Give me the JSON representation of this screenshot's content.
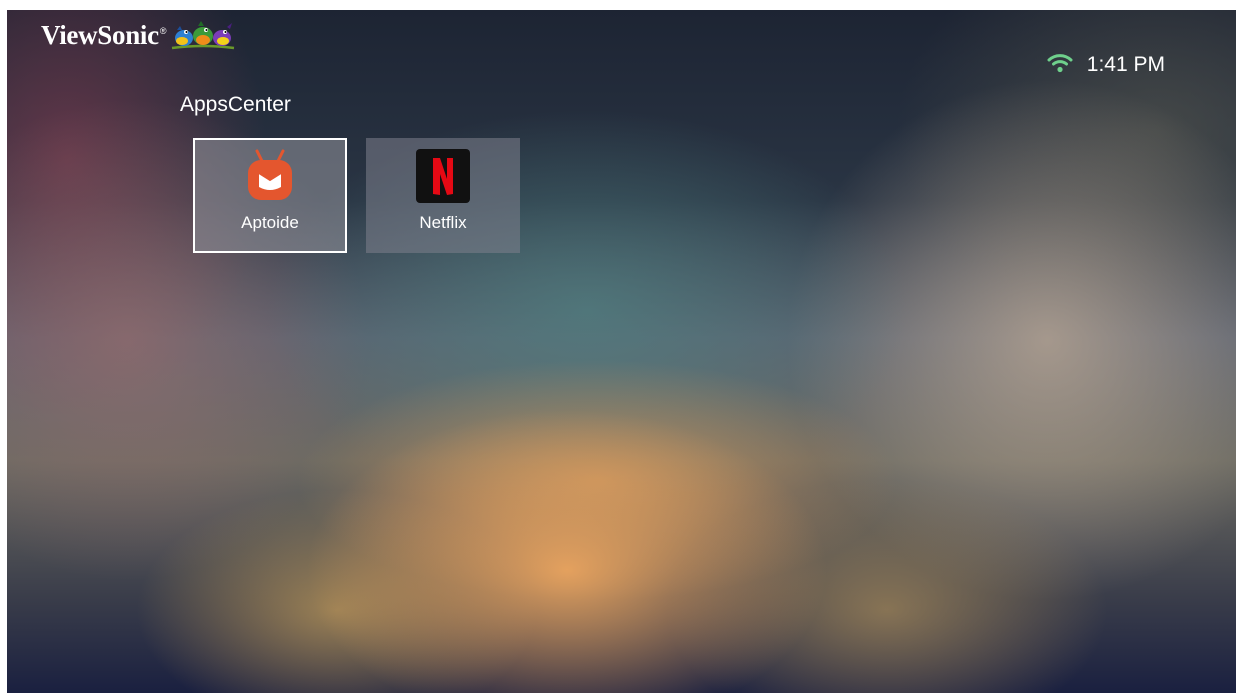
{
  "brand": {
    "name": "ViewSonic",
    "mark": "®"
  },
  "status": {
    "wifi_icon": "wifi-icon",
    "time": "1:41 PM",
    "wifi_color": "#6fd08c"
  },
  "section": {
    "title": "AppsCenter"
  },
  "apps": [
    {
      "label": "Aptoide",
      "icon": "aptoide-icon",
      "selected": true,
      "color": "#e4562e"
    },
    {
      "label": "Netflix",
      "icon": "netflix-icon",
      "selected": false,
      "color": "#e50914"
    }
  ]
}
